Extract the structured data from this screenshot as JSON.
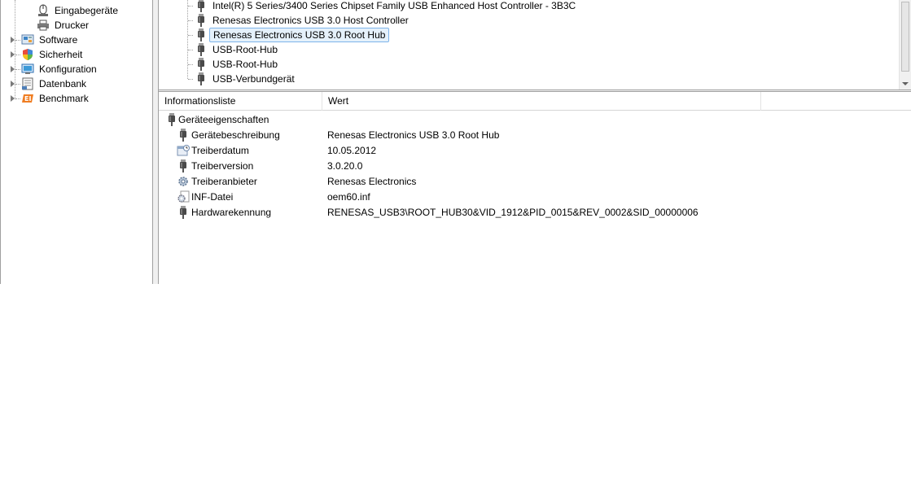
{
  "nav": {
    "items": [
      {
        "label": "Eingabegeräte",
        "icon": "keyboard-mouse-icon"
      },
      {
        "label": "Drucker",
        "icon": "printer-icon"
      },
      {
        "label": "Software",
        "icon": "software-icon"
      },
      {
        "label": "Sicherheit",
        "icon": "shield-icon"
      },
      {
        "label": "Konfiguration",
        "icon": "configuration-icon"
      },
      {
        "label": "Datenbank",
        "icon": "database-icon"
      },
      {
        "label": "Benchmark",
        "icon": "benchmark-icon"
      }
    ]
  },
  "device_tree": {
    "items": [
      {
        "label": "Intel(R) 5 Series/3400 Series Chipset Family USB Enhanced Host Controller - 3B3C",
        "icon": "usb-plug-icon"
      },
      {
        "label": "Renesas Electronics USB 3.0 Host Controller",
        "icon": "usb-plug-icon"
      },
      {
        "label": "Renesas Electronics USB 3.0 Root Hub",
        "icon": "usb-plug-icon",
        "selected": true
      },
      {
        "label": "USB-Root-Hub",
        "icon": "usb-plug-icon"
      },
      {
        "label": "USB-Root-Hub",
        "icon": "usb-plug-icon"
      },
      {
        "label": "USB-Verbundgerät",
        "icon": "usb-plug-icon"
      }
    ]
  },
  "details": {
    "columns": [
      "Informationsliste",
      "Wert"
    ],
    "group": "Geräteeigenschaften",
    "rows": [
      {
        "name": "Gerätebeschreibung",
        "value": "Renesas Electronics USB 3.0 Root Hub",
        "icon": "usb-plug-icon"
      },
      {
        "name": "Treiberdatum",
        "value": "10.05.2012",
        "icon": "calendar-icon"
      },
      {
        "name": "Treiberversion",
        "value": "3.0.20.0",
        "icon": "usb-plug-icon"
      },
      {
        "name": "Treiberanbieter",
        "value": "Renesas Electronics",
        "icon": "gear-icon"
      },
      {
        "name": "INF-Datei",
        "value": "oem60.inf",
        "icon": "gear-file-icon"
      },
      {
        "name": "Hardwarekennung",
        "value": "RENESAS_USB3\\ROOT_HUB30&VID_1912&PID_0015&REV_0002&SID_00000006",
        "icon": "usb-plug-icon"
      }
    ]
  },
  "colors": {
    "selection_bg": "#e5f1fb",
    "selection_border": "#7eb4ea"
  }
}
